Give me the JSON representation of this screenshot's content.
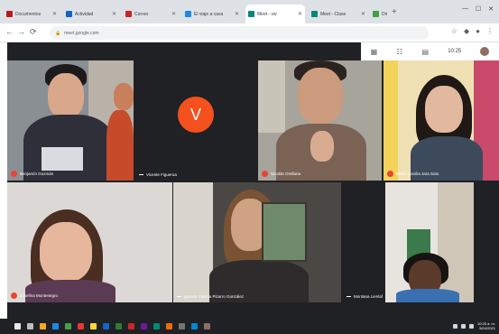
{
  "browser": {
    "tabs": [
      {
        "label": "Documentos",
        "color": "#b71c1c",
        "active": false
      },
      {
        "label": "Actividad",
        "color": "#1565c0",
        "active": false
      },
      {
        "label": "Correo",
        "color": "#c62828",
        "active": false
      },
      {
        "label": "El viaje a casa",
        "color": "#1e88e5",
        "active": false
      },
      {
        "label": "Meet - vw",
        "color": "#00897b",
        "active": true
      },
      {
        "label": "Meet - Clase",
        "color": "#00897b",
        "active": false
      },
      {
        "label": "Drive",
        "color": "#43a047",
        "active": false
      }
    ],
    "url": "meet.google.com"
  },
  "meet": {
    "clock": "10:25",
    "participants": [
      {
        "name": "Benjamín Guzmán",
        "mic_muted": true
      },
      {
        "name": "Vicente Figueroa",
        "mic_muted": false,
        "avatar_letter": "V",
        "avatar_color": "#f4511e"
      },
      {
        "name": "Nicolás Orellana",
        "mic_muted": true
      },
      {
        "name": "Karen Cecilia Jara Soto",
        "mic_muted": true
      },
      {
        "name": "Josefina Montenegro",
        "mic_muted": true
      },
      {
        "name": "Ignacia Carlota Pizarro González",
        "mic_muted": false
      },
      {
        "name": "Montana Lienlaf",
        "mic_muted": false
      },
      {
        "name": "",
        "mic_muted": false
      }
    ]
  },
  "taskbar": {
    "time": "10:25 a. m.",
    "date": "5/04/2021"
  }
}
